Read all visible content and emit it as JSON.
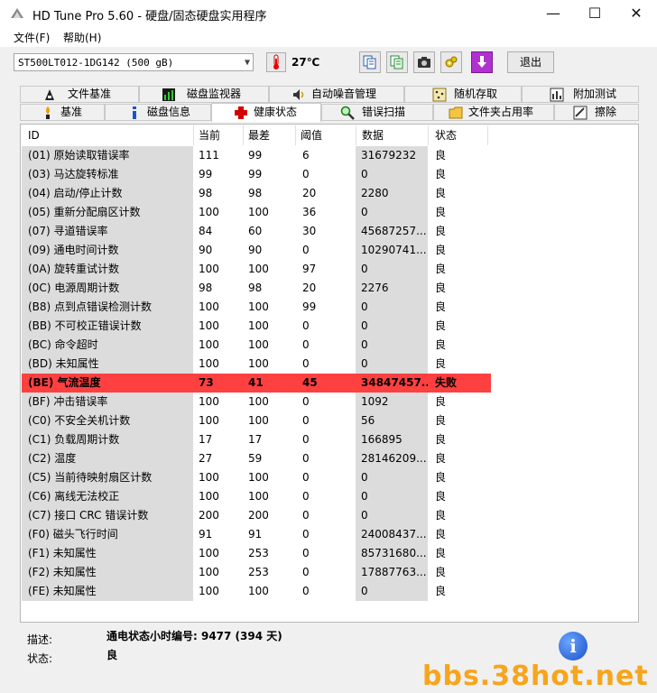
{
  "window": {
    "title": "HD Tune Pro 5.60 - 硬盘/固态硬盘实用程序",
    "minimize": "—",
    "maximize": "☐",
    "close": "✕"
  },
  "menu": [
    "文件(F)",
    "帮助(H)"
  ],
  "toolbar": {
    "drive": "ST500LT012-1DG142 (500 gB)",
    "temperature": "27℃",
    "exit_label": "退出",
    "icons": [
      "copy-icon",
      "copy-all-icon",
      "camera-icon",
      "options-icon",
      "download-icon"
    ]
  },
  "tabs_top": [
    {
      "label": "文件基准",
      "icon": "file-benchmark-icon"
    },
    {
      "label": "磁盘监视器",
      "icon": "disk-monitor-icon"
    },
    {
      "label": "自动噪音管理",
      "icon": "speaker-icon"
    },
    {
      "label": "随机存取",
      "icon": "random-access-icon"
    },
    {
      "label": "附加测试",
      "icon": "extra-tests-icon"
    }
  ],
  "tabs_bottom": [
    {
      "label": "基准",
      "icon": "benchmark-icon"
    },
    {
      "label": "磁盘信息",
      "icon": "info-icon"
    },
    {
      "label": "健康状态",
      "icon": "health-cross-icon",
      "active": true
    },
    {
      "label": "错误扫描",
      "icon": "search-icon"
    },
    {
      "label": "文件夹占用率",
      "icon": "folder-icon"
    },
    {
      "label": "擦除",
      "icon": "erase-icon"
    }
  ],
  "table": {
    "headers": [
      "ID",
      "当前",
      "最差",
      "阈值",
      "数据",
      "状态"
    ],
    "rows": [
      {
        "id": "(01) 原始读取错误率",
        "cur": "111",
        "worst": "99",
        "thr": "6",
        "data": "31679232",
        "status": "良"
      },
      {
        "id": "(03) 马达旋转标准",
        "cur": "99",
        "worst": "99",
        "thr": "0",
        "data": "0",
        "status": "良"
      },
      {
        "id": "(04) 启动/停止计数",
        "cur": "98",
        "worst": "98",
        "thr": "20",
        "data": "2280",
        "status": "良"
      },
      {
        "id": "(05) 重新分配扇区计数",
        "cur": "100",
        "worst": "100",
        "thr": "36",
        "data": "0",
        "status": "良"
      },
      {
        "id": "(07) 寻道错误率",
        "cur": "84",
        "worst": "60",
        "thr": "30",
        "data": "45687257...",
        "status": "良"
      },
      {
        "id": "(09) 通电时间计数",
        "cur": "90",
        "worst": "90",
        "thr": "0",
        "data": "10290741...",
        "status": "良"
      },
      {
        "id": "(0A) 旋转重试计数",
        "cur": "100",
        "worst": "100",
        "thr": "97",
        "data": "0",
        "status": "良"
      },
      {
        "id": "(0C) 电源周期计数",
        "cur": "98",
        "worst": "98",
        "thr": "20",
        "data": "2276",
        "status": "良"
      },
      {
        "id": "(B8) 点到点错误检测计数",
        "cur": "100",
        "worst": "100",
        "thr": "99",
        "data": "0",
        "status": "良"
      },
      {
        "id": "(BB) 不可校正错误计数",
        "cur": "100",
        "worst": "100",
        "thr": "0",
        "data": "0",
        "status": "良"
      },
      {
        "id": "(BC) 命令超时",
        "cur": "100",
        "worst": "100",
        "thr": "0",
        "data": "0",
        "status": "良"
      },
      {
        "id": "(BD) 未知属性",
        "cur": "100",
        "worst": "100",
        "thr": "0",
        "data": "0",
        "status": "良"
      },
      {
        "id": "(BE) 气流温度",
        "cur": "73",
        "worst": "41",
        "thr": "45",
        "data": "34847457...",
        "status": "失败",
        "fail": true
      },
      {
        "id": "(BF) 冲击错误率",
        "cur": "100",
        "worst": "100",
        "thr": "0",
        "data": "1092",
        "status": "良"
      },
      {
        "id": "(C0) 不安全关机计数",
        "cur": "100",
        "worst": "100",
        "thr": "0",
        "data": "56",
        "status": "良"
      },
      {
        "id": "(C1) 负载周期计数",
        "cur": "17",
        "worst": "17",
        "thr": "0",
        "data": "166895",
        "status": "良"
      },
      {
        "id": "(C2) 温度",
        "cur": "27",
        "worst": "59",
        "thr": "0",
        "data": "28146209...",
        "status": "良"
      },
      {
        "id": "(C5) 当前待映射扇区计数",
        "cur": "100",
        "worst": "100",
        "thr": "0",
        "data": "0",
        "status": "良"
      },
      {
        "id": "(C6) 离线无法校正",
        "cur": "100",
        "worst": "100",
        "thr": "0",
        "data": "0",
        "status": "良"
      },
      {
        "id": "(C7) 接口 CRC 错误计数",
        "cur": "200",
        "worst": "200",
        "thr": "0",
        "data": "0",
        "status": "良"
      },
      {
        "id": "(F0) 磁头飞行时间",
        "cur": "91",
        "worst": "91",
        "thr": "0",
        "data": "24008437...",
        "status": "良"
      },
      {
        "id": "(F1) 未知属性",
        "cur": "100",
        "worst": "253",
        "thr": "0",
        "data": "85731680...",
        "status": "良"
      },
      {
        "id": "(F2) 未知属性",
        "cur": "100",
        "worst": "253",
        "thr": "0",
        "data": "17887763...",
        "status": "良"
      },
      {
        "id": "(FE) 未知属性",
        "cur": "100",
        "worst": "100",
        "thr": "0",
        "data": "0",
        "status": "良"
      }
    ]
  },
  "details": {
    "desc_label": "描述:",
    "desc_value": "通电状态小时编号: 9477 (394 天)",
    "status_label": "状态:",
    "status_value": "良"
  },
  "info_button": "i",
  "watermark": "bbs.38hot.net"
}
